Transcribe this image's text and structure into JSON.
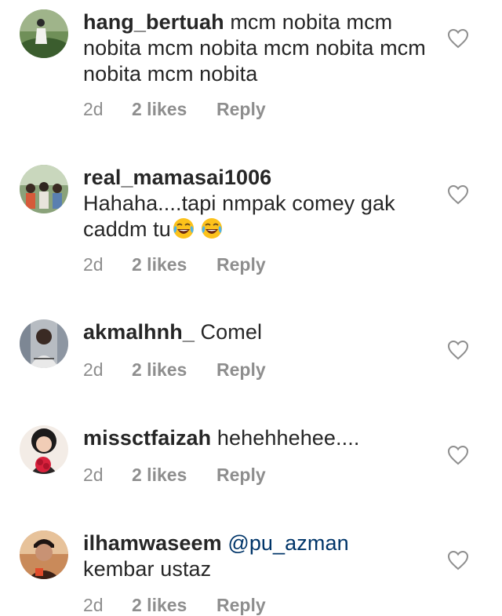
{
  "comments": [
    {
      "username": "hang_bertuah",
      "text": " mcm nobita mcm nobita mcm nobita mcm nobita mcm nobita mcm nobita",
      "time": "2d",
      "likes": "2 likes",
      "reply": "Reply",
      "avatar_colors": [
        "#3b5d2e",
        "#dfe8d6"
      ]
    },
    {
      "username": "real_mamasai1006",
      "text_before_emoji": "Hahaha....tapi nmpak comey gak caddm tu",
      "emojis": [
        "face-with-tears-of-joy-icon",
        "face-with-tears-of-joy-icon"
      ],
      "time": "2d",
      "likes": "2 likes",
      "reply": "Reply",
      "avatar_colors": [
        "#4a6b3a",
        "#b8c9a8"
      ]
    },
    {
      "username": "akmalhnh_",
      "text": " Comel",
      "time": "2d",
      "likes": "2 likes",
      "reply": "Reply",
      "avatar_colors": [
        "#5b6470",
        "#cfd3d8"
      ]
    },
    {
      "username": "missctfaizah",
      "text": " hehehhehee....",
      "time": "2d",
      "likes": "2 likes",
      "reply": "Reply",
      "avatar_colors": [
        "#e0294a",
        "#f5d4cf"
      ]
    },
    {
      "username": "ilhamwaseem",
      "mention": "@pu_azman",
      "text": "kembar ustaz",
      "time": "2d",
      "likes": "2 likes",
      "reply": "Reply",
      "avatar_colors": [
        "#6a3a2a",
        "#d9b48f"
      ]
    }
  ],
  "colors": {
    "text": "#262626",
    "meta": "#8e8e8e",
    "mention": "#003569"
  }
}
